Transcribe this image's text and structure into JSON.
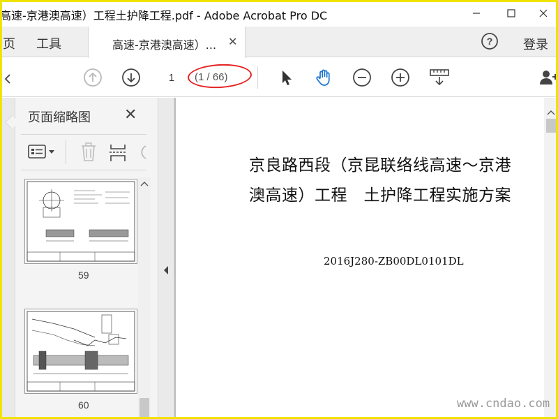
{
  "window": {
    "title": "高速-京港澳高速）工程土护降工程.pdf - Adobe Acrobat Pro DC"
  },
  "menubar": {
    "items": [
      "页",
      "工具"
    ],
    "tab_label": "高速-京港澳高速）...",
    "login_label": "登录"
  },
  "toolbar": {
    "current_page": "1",
    "page_count": "(1 / 66)"
  },
  "left_pane": {
    "title": "页面缩略图",
    "thumbnails": [
      {
        "label": "59"
      },
      {
        "label": "60"
      }
    ]
  },
  "document": {
    "title_line1": "京良路西段（京昆联络线高速～京港",
    "title_line2": "澳高速）工程　土护降工程实施方案",
    "code": "2016J280-ZB00DL0101DL"
  },
  "watermark": "www.cndao.com",
  "colors": {
    "frame": "#f0e300",
    "highlight": "#e52222",
    "accent_hand": "#1a73d0"
  },
  "icons": {
    "toolbar": [
      "prev-page-icon",
      "next-page-icon",
      "select-arrow-icon",
      "hand-tool-icon",
      "zoom-out-icon",
      "zoom-in-icon",
      "scan-ruler-icon",
      "add-user-icon"
    ],
    "pane": [
      "thumbnail-options-icon",
      "trash-icon",
      "extract-icon",
      "rotate-icon"
    ]
  }
}
